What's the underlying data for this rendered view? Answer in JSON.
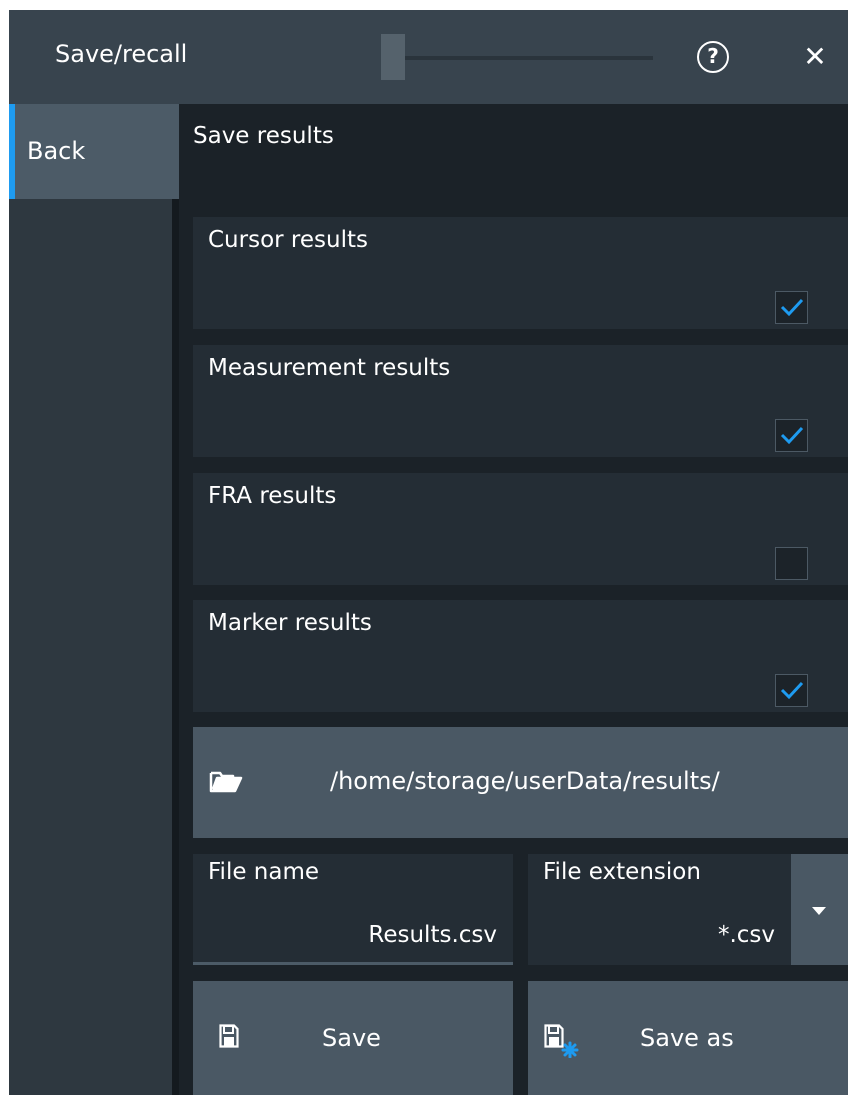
{
  "dialog": {
    "title": "Save/recall",
    "help_icon": "question-circle-icon",
    "close_icon": "close-x-icon"
  },
  "nav": {
    "back_label": "Back",
    "accent_color": "#1e9bf0"
  },
  "main": {
    "section_title": "Save results",
    "options": [
      {
        "label": "Cursor results",
        "checked": true
      },
      {
        "label": "Measurement results",
        "checked": true
      },
      {
        "label": "FRA results",
        "checked": false
      },
      {
        "label": "Marker results",
        "checked": true
      }
    ],
    "path": {
      "icon": "folder-open-icon",
      "value": "/home/storage/userData/results/"
    },
    "file_name": {
      "label": "File name",
      "value": "Results.csv"
    },
    "file_extension": {
      "label": "File extension",
      "value": "*.csv",
      "dropdown_icon": "triangle-down-icon"
    },
    "buttons": {
      "save": {
        "label": "Save",
        "icon": "floppy-disk-icon"
      },
      "save_as": {
        "label": "Save as",
        "icon": "floppy-disk-star-icon"
      }
    }
  }
}
